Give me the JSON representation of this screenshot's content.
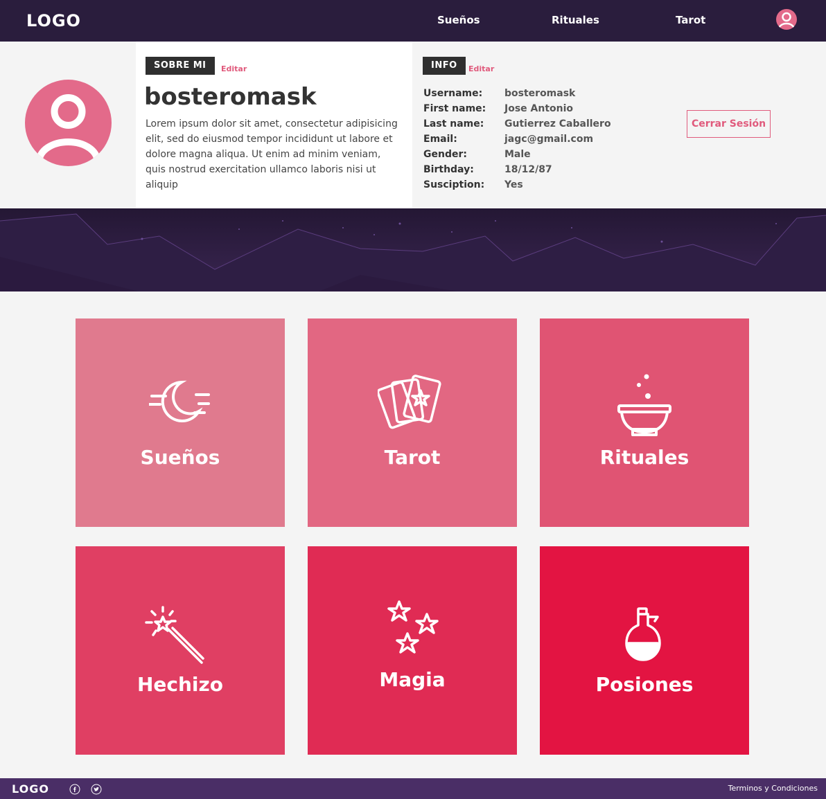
{
  "header": {
    "logo": "LOGO",
    "nav": [
      "Sueños",
      "Rituales",
      "Tarot"
    ]
  },
  "profile": {
    "about_tag": "SOBRE MI",
    "about_edit": "Editar",
    "username": "bosteromask",
    "about_text": "Lorem ipsum dolor sit amet, consectetur adipisicing elit, sed do eiusmod tempor incididunt ut labore et dolore magna aliqua. Ut enim ad minim veniam, quis nostrud exercitation ullamco laboris nisi ut aliquip",
    "info_tag": "INFO",
    "info_edit": "Editar",
    "info": [
      {
        "label": "Username:",
        "value": "bosteromask"
      },
      {
        "label": "First name:",
        "value": "Jose Antonio"
      },
      {
        "label": "Last name:",
        "value": "Gutierrez Caballero"
      },
      {
        "label": "Email:",
        "value": "jagc@gmail.com"
      },
      {
        "label": "Gender:",
        "value": "Male"
      },
      {
        "label": "Birthday:",
        "value": "18/12/87"
      },
      {
        "label": "Susciption:",
        "value": "Yes"
      }
    ],
    "logout": "Cerrar Sesión"
  },
  "tiles": [
    {
      "label": "Sueños",
      "icon": "moon-icon",
      "color": "#e07a8e"
    },
    {
      "label": "Tarot",
      "icon": "tarot-cards-icon",
      "color": "#e26782"
    },
    {
      "label": "Rituales",
      "icon": "cauldron-icon",
      "color": "#e05473"
    },
    {
      "label": "Hechizo",
      "icon": "magic-wand-icon",
      "color": "#e03f63"
    },
    {
      "label": "Magia",
      "icon": "stars-icon",
      "color": "#e02b54"
    },
    {
      "label": "Posiones",
      "icon": "potion-icon",
      "color": "#e31442"
    }
  ],
  "footer": {
    "logo": "LOGO",
    "terms": "Terminos y Condiciones"
  },
  "colors": {
    "nav_bg": "#2a1d3d",
    "footer_bg": "#4a2e66",
    "accent": "#e05a7c"
  }
}
